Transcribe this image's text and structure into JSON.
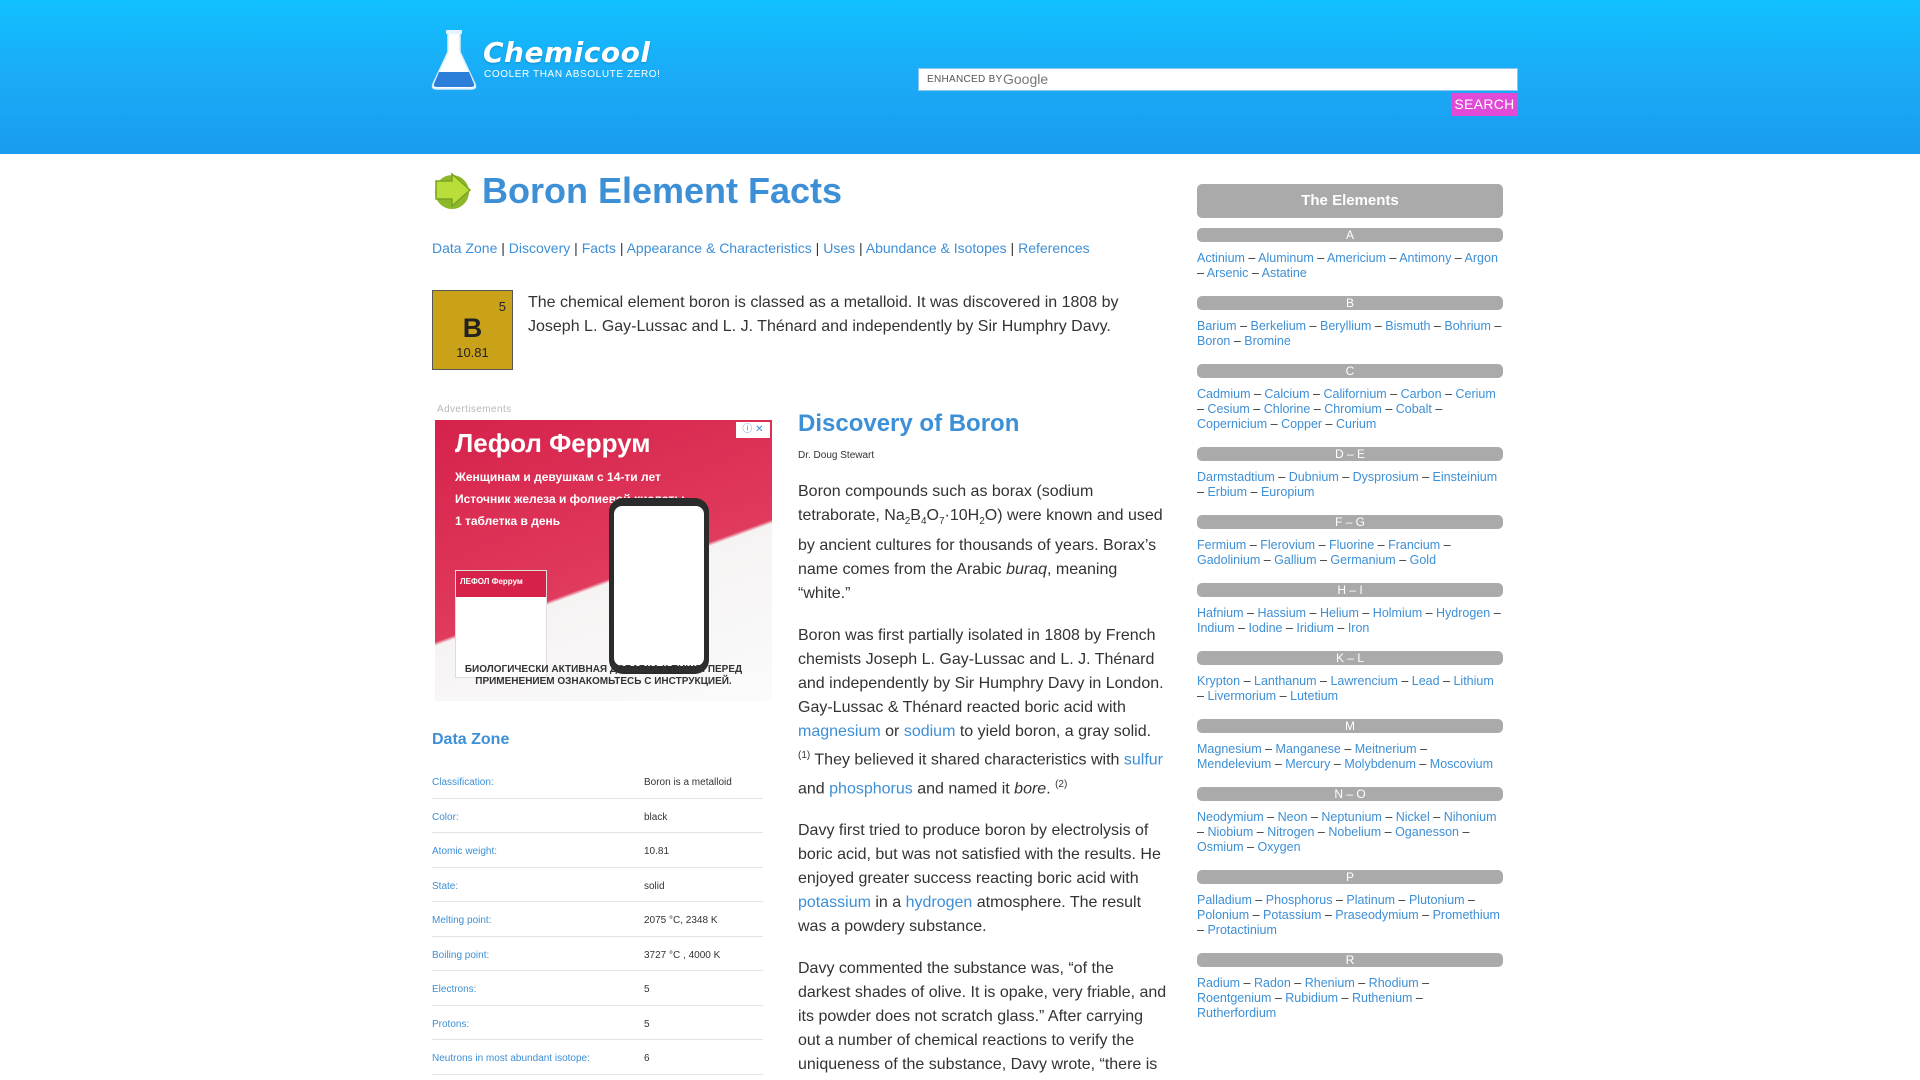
{
  "header": {
    "brand": "Chemicool",
    "tagline": "COOLER THAN ABSOLUTE ZERO!",
    "search_enhanced": "ENHANCED BY",
    "search_google": "Google",
    "search_button": "SEARCH",
    "accent": "#1ba9f5",
    "button_color": "#e04ad6"
  },
  "page": {
    "title": "Boron Element Facts",
    "toc": [
      "Data Zone",
      "Discovery",
      "Facts",
      "Appearance & Characteristics",
      "Uses",
      "Abundance & Isotopes",
      "References"
    ],
    "toc_separator": "|"
  },
  "element": {
    "number": "5",
    "symbol": "B",
    "weight": "10.81",
    "tile_color": "#c9a21a"
  },
  "intro": "The chemical element boron is classed as a metalloid. It was discovered in 1808 by Joseph L. Gay-Lussac and L. J. Thénard and independently by Sir Humphry Davy.",
  "ad": {
    "label": "Advertisements",
    "title": "Лефол Феррум",
    "lines": [
      "Женщинам и девушкам с 14-ти лет",
      "Источник железа и фолиевой кислоты",
      "1 таблетка в день"
    ],
    "footer": "БИОЛОГИЧЕСКИ АКТИВНАЯ ДОБАВКА К ПИЩЕ. ПЕРЕД ПРИМЕНЕНИЕМ ОЗНАКОМЬТЕСЬ С ИНСТРУКЦИЕЙ.",
    "box_label": "ЛЕФОЛ Феррум"
  },
  "data_zone": {
    "title": "Data Zone",
    "rows": [
      {
        "label": "Classification:",
        "value": "Boron is a metalloid"
      },
      {
        "label": "Color:",
        "value": "black"
      },
      {
        "label": "Atomic weight:",
        "value": "10.81"
      },
      {
        "label": "State:",
        "value": "solid"
      },
      {
        "label": "Melting point:",
        "value": "2075 °C, 2348 K"
      },
      {
        "label": "Boiling point:",
        "value": "3727 °C , 4000 K"
      },
      {
        "label": "Electrons:",
        "value": "5"
      },
      {
        "label": "Protons:",
        "value": "5"
      },
      {
        "label": "Neutrons in most abundant isotope:",
        "value": "6"
      }
    ]
  },
  "article": {
    "heading": "Discovery of Boron",
    "author": "Dr. Doug Stewart",
    "p1_a": "Boron compounds such as borax (sodium tetraborate, Na",
    "p1_sub1": "2",
    "p1_b": "B",
    "p1_sub2": "4",
    "p1_c": "O",
    "p1_sub3": "7",
    "p1_d": "·10H",
    "p1_sub4": "2",
    "p1_e": "O) were known and used by ancient cultures for thousands of years. Borax’s name comes from the Arabic ",
    "p1_italic": "buraq",
    "p1_f": ", meaning “white.”",
    "p2_a": "Boron was first partially isolated in 1808 by French chemists Joseph L. Gay-Lussac and L. J. Thénard and independently by Sir Humphry Davy in London. Gay-Lussac & Thénard reacted boric acid with ",
    "p2_link1": "magnesium",
    "p2_b": " or ",
    "p2_link2": "sodium",
    "p2_c": " to yield boron, a gray solid.",
    "p2_sup1": "(1)",
    "p2_d": " They believed it shared characteristics with ",
    "p2_link3": "sulfur",
    "p2_e": " and ",
    "p2_link4": "phosphorus",
    "p2_f": " and named it ",
    "p2_italic": "bore",
    "p2_g": ". ",
    "p2_sup2": "(2)",
    "p3_a": "Davy first tried to produce boron by electrolysis of boric acid, but was not satisfied with the results. He enjoyed greater success reacting boric acid with ",
    "p3_link1": "potassium",
    "p3_b": " in a ",
    "p3_link2": "hydrogen",
    "p3_c": " atmosphere. The result was a powdery substance.",
    "p4": "Davy commented the substance was, “of the darkest shades of olive. It is opake, very friable, and its powder does not scratch glass.” After carrying out a number of chemical reactions to verify the uniqueness of the substance, Davy wrote, “there is strong reason to consider the boracic basis as"
  },
  "sidebar": {
    "title": "The Elements",
    "groups": [
      {
        "letter": "A",
        "items": [
          "Actinium",
          "Aluminum",
          "Americium",
          "Antimony",
          "Argon",
          "Arsenic",
          "Astatine"
        ]
      },
      {
        "letter": "B",
        "items": [
          "Barium",
          "Berkelium",
          "Beryllium",
          "Bismuth",
          "Bohrium",
          "Boron",
          "Bromine"
        ]
      },
      {
        "letter": "C",
        "items": [
          "Cadmium",
          "Calcium",
          "Californium",
          "Carbon",
          "Cerium",
          "Cesium",
          "Chlorine",
          "Chromium",
          "Cobalt",
          "Copernicium",
          "Copper",
          "Curium"
        ]
      },
      {
        "letter": "D – E",
        "items": [
          "Darmstadtium",
          "Dubnium",
          "Dysprosium",
          "Einsteinium",
          "Erbium",
          "Europium"
        ]
      },
      {
        "letter": "F – G",
        "items": [
          "Fermium",
          "Flerovium",
          "Fluorine",
          "Francium",
          "Gadolinium",
          "Gallium",
          "Germanium",
          "Gold"
        ]
      },
      {
        "letter": "H – I",
        "items": [
          "Hafnium",
          "Hassium",
          "Helium",
          "Holmium",
          "Hydrogen",
          "Indium",
          "Iodine",
          "Iridium",
          "Iron"
        ]
      },
      {
        "letter": "K – L",
        "items": [
          "Krypton",
          "Lanthanum",
          "Lawrencium",
          "Lead",
          "Lithium",
          "Livermorium",
          "Lutetium"
        ]
      },
      {
        "letter": "M",
        "items": [
          "Magnesium",
          "Manganese",
          "Meitnerium",
          "Mendelevium",
          "Mercury",
          "Molybdenum",
          "Moscovium"
        ]
      },
      {
        "letter": "N – O",
        "items": [
          "Neodymium",
          "Neon",
          "Neptunium",
          "Nickel",
          "Nihonium",
          "Niobium",
          "Nitrogen",
          "Nobelium",
          "Oganesson",
          "Osmium",
          "Oxygen"
        ]
      },
      {
        "letter": "P",
        "items": [
          "Palladium",
          "Phosphorus",
          "Platinum",
          "Plutonium",
          "Polonium",
          "Potassium",
          "Praseodymium",
          "Promethium",
          "Protactinium"
        ]
      },
      {
        "letter": "R",
        "items": [
          "Radium",
          "Radon",
          "Rhenium",
          "Rhodium",
          "Roentgenium",
          "Rubidium",
          "Ruthenium",
          "Rutherfordium"
        ]
      }
    ],
    "separator": " – "
  }
}
